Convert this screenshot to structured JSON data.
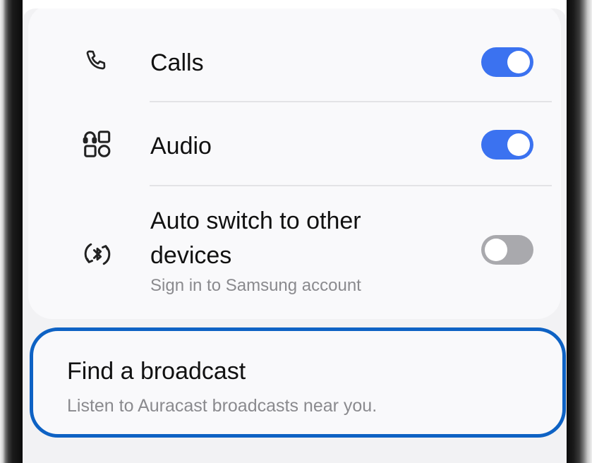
{
  "settings": {
    "calls": {
      "label": "Calls",
      "icon": "phone-icon",
      "enabled": true
    },
    "audio": {
      "label": "Audio",
      "icon": "audio-apps-icon",
      "enabled": true
    },
    "auto_switch": {
      "label_line1": "Auto switch to other",
      "label_line2": "devices",
      "sublabel": "Sign in to Samsung account",
      "icon": "bluetooth-sync-icon",
      "enabled": false
    }
  },
  "broadcast": {
    "title": "Find a broadcast",
    "subtitle": "Listen to Auracast broadcasts near you."
  },
  "colors": {
    "toggle_on": "#3b72f0",
    "toggle_off": "#a9a9ad",
    "highlight_border": "#0e62c4"
  }
}
